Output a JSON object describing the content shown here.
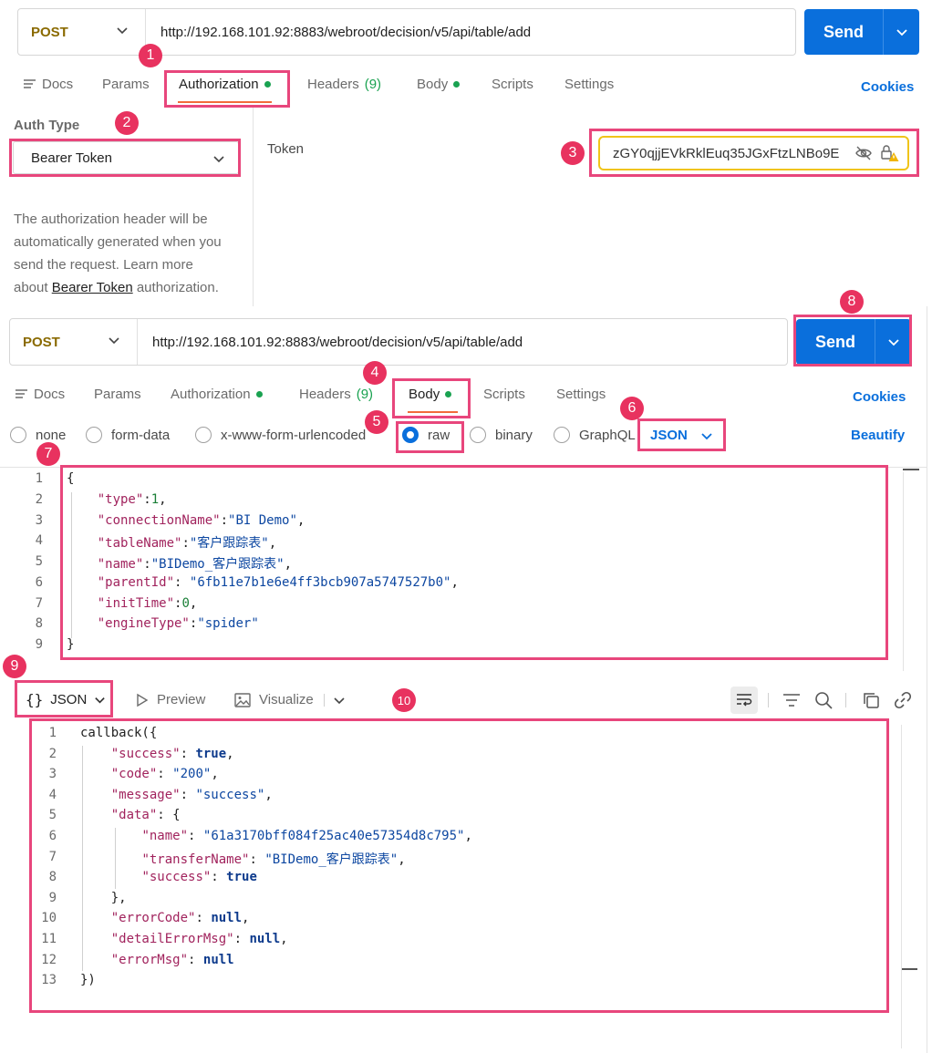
{
  "top": {
    "method": "POST",
    "url": "http://192.168.101.92:8883/webroot/decision/v5/api/table/add",
    "send_label": "Send",
    "tabs": [
      "Docs",
      "Params",
      "Authorization",
      "Headers",
      "(9)",
      "Body",
      "Scripts",
      "Settings"
    ],
    "cookies": "Cookies"
  },
  "auth": {
    "type_label": "Auth Type",
    "type_value": "Bearer Token",
    "description_1": "The authorization header will be",
    "description_2": "automatically generated when you",
    "description_3": "send the request. Learn more",
    "description_4a": "about ",
    "description_link": "Bearer Token",
    "description_4b": " authorization.",
    "token_label": "Token",
    "token_value": "zGY0qjjEVkRklEuq35JGxFtzLNBo9E"
  },
  "second": {
    "method": "POST",
    "url": "http://192.168.101.92:8883/webroot/decision/v5/api/table/add",
    "send_label": "Send",
    "tabs": [
      "Docs",
      "Params",
      "Authorization",
      "Headers",
      "(9)",
      "Body",
      "Scripts",
      "Settings"
    ],
    "cookies": "Cookies",
    "body_modes": [
      "none",
      "form-data",
      "x-www-form-urlencoded",
      "raw",
      "binary",
      "GraphQL"
    ],
    "format": "JSON",
    "beautify": "Beautify"
  },
  "request_body_lines": [
    "{",
    "    \"type\":1,",
    "    \"connectionName\":\"BI Demo\",",
    "    \"tableName\":\"客户跟踪表\",",
    "    \"name\":\"BIDemo_客户跟踪表\",",
    "    \"parentId\": \"6fb11e7b1e6e4ff3bcb907a5747527b0\",",
    "    \"initTime\":0,",
    "    \"engineType\":\"spider\"",
    "}"
  ],
  "response": {
    "format": "JSON",
    "preview": "Preview",
    "visualize": "Visualize",
    "lines": [
      "callback({",
      "    \"success\": true,",
      "    \"code\": \"200\",",
      "    \"message\": \"success\",",
      "    \"data\": {",
      "        \"name\": \"61a3170bff084f25ac40e57354d8c795\",",
      "        \"transferName\": \"BIDemo_客户跟踪表\",",
      "        \"success\": true",
      "    },",
      "    \"errorCode\": null,",
      "    \"detailErrorMsg\": null,",
      "    \"errorMsg\": null",
      "})"
    ]
  },
  "badges": [
    "1",
    "2",
    "3",
    "4",
    "5",
    "6",
    "7",
    "8",
    "9",
    "10"
  ],
  "colors": {
    "accent": "#0a6fdc",
    "callout": "#e8467c",
    "badge": "#e8325f",
    "active_underline": "#f26b3a",
    "dot": "#1aa251"
  }
}
